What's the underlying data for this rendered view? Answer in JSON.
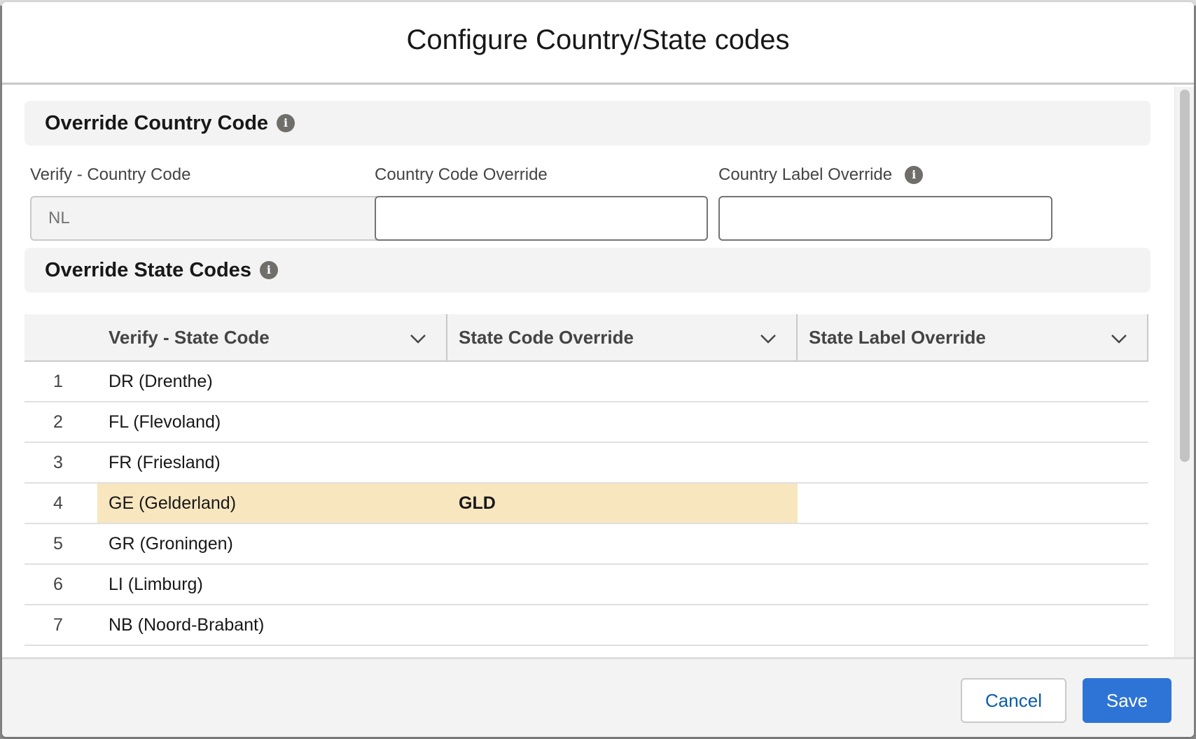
{
  "modal": {
    "title": "Configure Country/State codes"
  },
  "country_section": {
    "title": "Override Country Code",
    "info_icon": "info-icon",
    "fields": [
      {
        "label": "Verify - Country Code",
        "value": "NL",
        "placeholder": "",
        "readonly": true
      },
      {
        "label": "Country Code Override",
        "value": "",
        "placeholder": ""
      },
      {
        "label": "Country Label Override",
        "value": "",
        "placeholder": "",
        "has_info": true
      }
    ]
  },
  "state_section": {
    "title": "Override State Codes",
    "info_icon": "info-icon"
  },
  "grid": {
    "columns": [
      "Verify - State Code",
      "State Code Override",
      "State Label Override"
    ],
    "rows": [
      {
        "num": "1",
        "state": "DR (Drenthe)",
        "code_override": "",
        "label_override": ""
      },
      {
        "num": "2",
        "state": "FL (Flevoland)",
        "code_override": "",
        "label_override": ""
      },
      {
        "num": "3",
        "state": "FR (Friesland)",
        "code_override": "",
        "label_override": ""
      },
      {
        "num": "4",
        "state": "GE (Gelderland)",
        "code_override": "GLD",
        "label_override": "",
        "edited": true
      },
      {
        "num": "5",
        "state": "GR (Groningen)",
        "code_override": "",
        "label_override": ""
      },
      {
        "num": "6",
        "state": "LI (Limburg)",
        "code_override": "",
        "label_override": ""
      },
      {
        "num": "7",
        "state": "NB (Noord-Brabant)",
        "code_override": "",
        "label_override": ""
      }
    ]
  },
  "footer": {
    "cancel_label": "Cancel",
    "save_label": "Save"
  },
  "colors": {
    "brand": "#2e74d6",
    "edited_cell": "#f8e6bf",
    "link_text": "#0b5cab"
  }
}
